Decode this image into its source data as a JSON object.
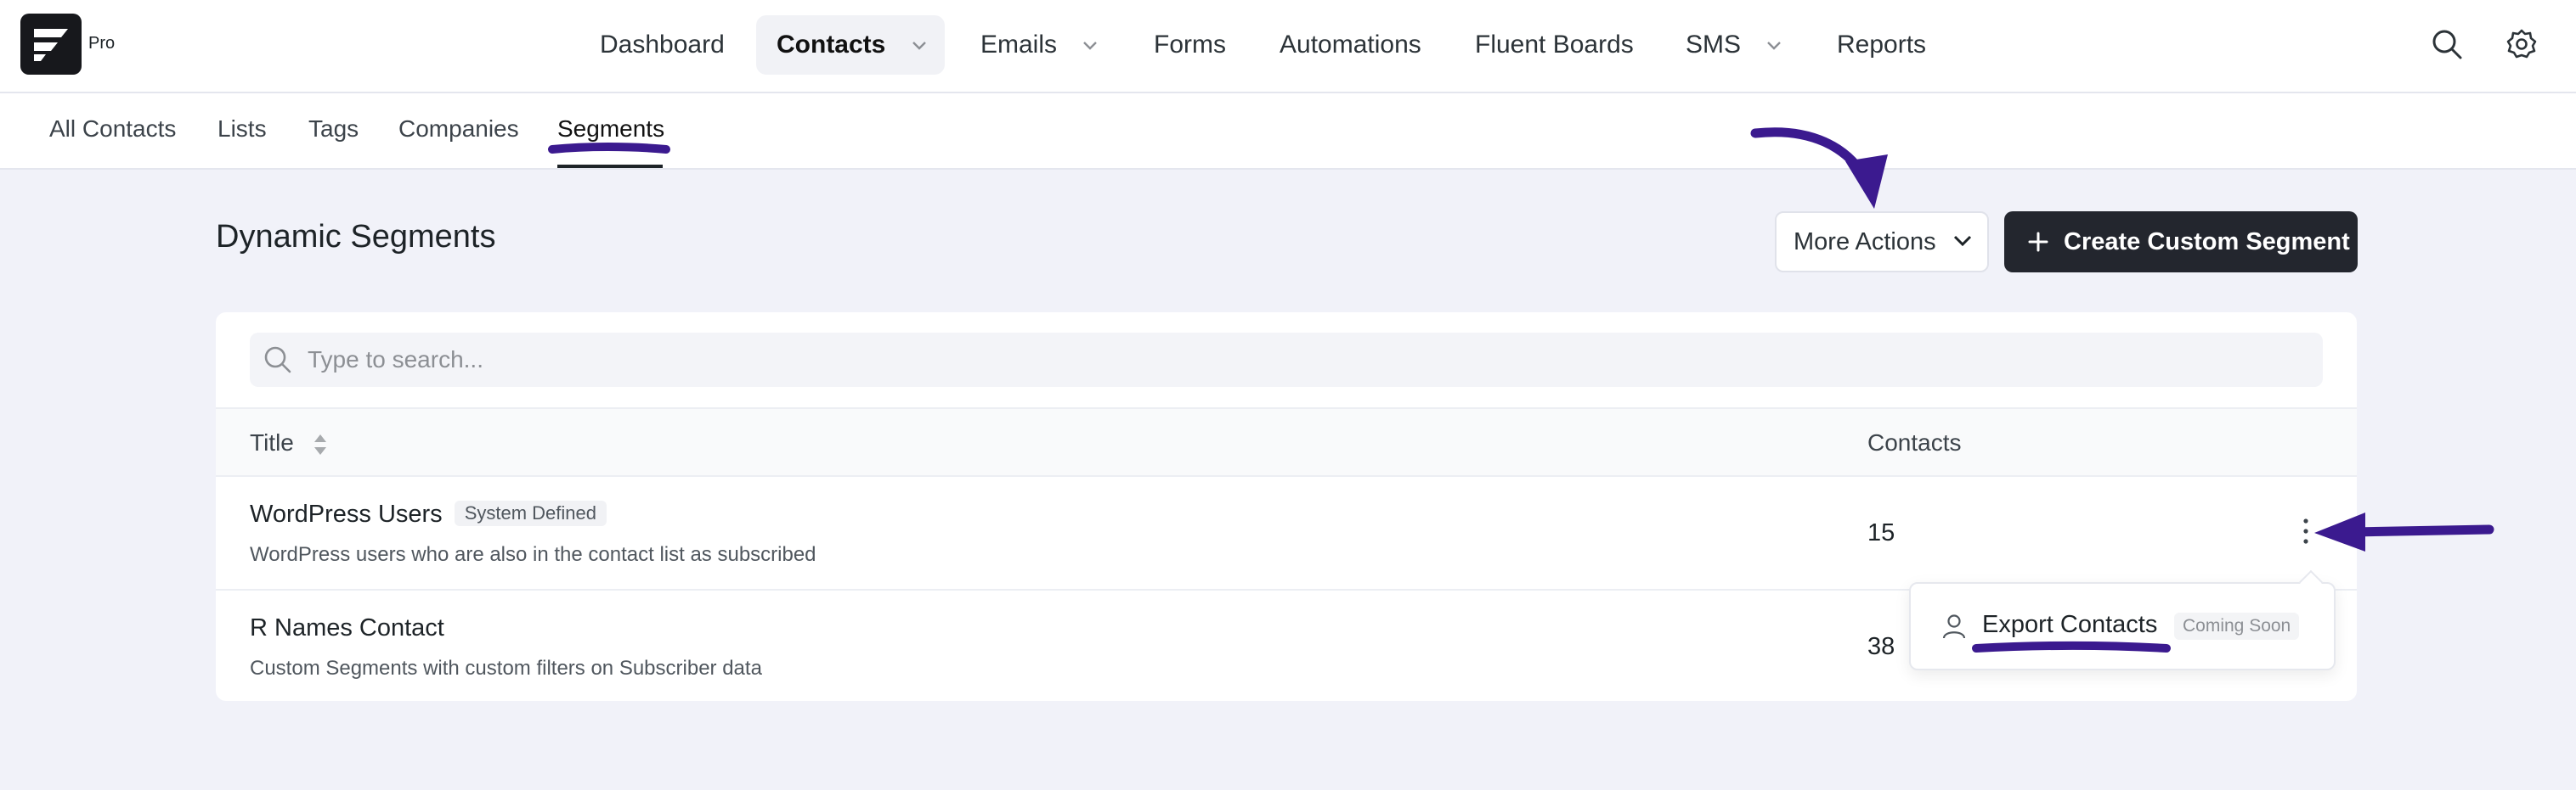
{
  "app": {
    "logo_badge": "Pro"
  },
  "nav": {
    "items": [
      {
        "label": "Dashboard"
      },
      {
        "label": "Contacts"
      },
      {
        "label": "Emails"
      },
      {
        "label": "Forms"
      },
      {
        "label": "Automations"
      },
      {
        "label": "Fluent Boards"
      },
      {
        "label": "SMS"
      },
      {
        "label": "Reports"
      }
    ],
    "active": "Contacts"
  },
  "subnav": {
    "items": [
      {
        "label": "All Contacts"
      },
      {
        "label": "Lists"
      },
      {
        "label": "Tags"
      },
      {
        "label": "Companies"
      },
      {
        "label": "Segments"
      }
    ],
    "active": "Segments"
  },
  "page": {
    "title": "Dynamic Segments",
    "more_actions_label": "More Actions",
    "create_label": "Create Custom Segment"
  },
  "search": {
    "placeholder": "Type to search..."
  },
  "table": {
    "columns": [
      "Title",
      "Contacts"
    ],
    "rows": [
      {
        "title": "WordPress Users",
        "badge": "System Defined",
        "description": "WordPress users who are also in the contact list as subscribed",
        "contacts": "15"
      },
      {
        "title": "R Names Contact",
        "badge": "",
        "description": "Custom Segments with custom filters on Subscriber data",
        "contacts": "38"
      }
    ]
  },
  "row_menu": {
    "item_label": "Export Contacts",
    "item_badge": "Coming Soon"
  },
  "colors": {
    "accent_annotation": "#3b1a8f",
    "primary_button": "#23262e",
    "background": "#f1f2f9"
  }
}
